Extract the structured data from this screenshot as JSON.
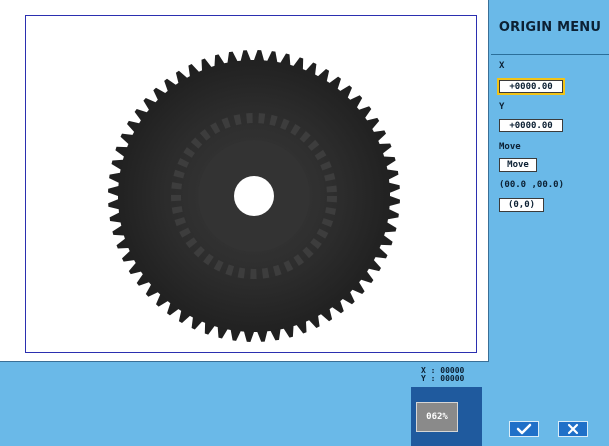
{
  "menu": {
    "title": "ORIGIN  MENU"
  },
  "fields": {
    "x_label": "X",
    "x_value": "+0000.00",
    "y_label": "Y",
    "y_value": "+0000.00",
    "move_label": "Move",
    "move_button": "Move",
    "offset_text": "(00.0 ,00.0)",
    "reset_button": "(0,0)"
  },
  "status": {
    "x_readout": "X : 00000",
    "y_readout": "Y : 00000",
    "zoom": "062%"
  },
  "icons": {
    "confirm": "check-icon",
    "cancel": "close-icon"
  },
  "colors": {
    "panel": "#6ab9e8",
    "frame_border": "#2b2fb0",
    "focus": "#f2c316",
    "button_blue": "#1f70c8",
    "gear": "#2a2a2a"
  }
}
